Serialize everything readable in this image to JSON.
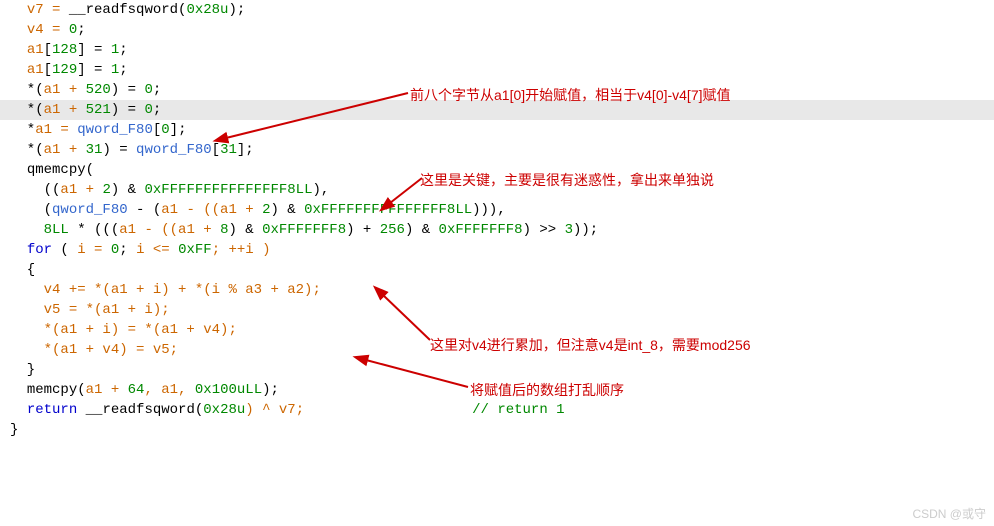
{
  "code": {
    "l1_v": "v7 = ",
    "l1_f": "__readfsqword",
    "l1_n": "0x28u",
    "l2_v": "v4 = ",
    "l2_n": "0",
    "l3_v": "a1",
    "l3_i": "128",
    "l3_n": "1",
    "l4_v": "a1",
    "l4_i": "129",
    "l4_n": "1",
    "l5_v": "a1 + ",
    "l5_i": "520",
    "l5_n": "0",
    "l6_v": "a1 + ",
    "l6_i": "521",
    "l6_n": "0",
    "l7_v": "a1 = ",
    "l7_a": "qword_F80",
    "l7_i": "0",
    "l8_v": "a1 + ",
    "l8_i": "31",
    "l8_a": "qword_F80",
    "l8_i2": "31",
    "l9": "qmemcpy(",
    "l10_v1": "a1 + ",
    "l10_n1": "2",
    "l10_n2": "0xFFFFFFFFFFFFFFF8LL",
    "l11_a": "qword_F80",
    "l11_v": "a1 - ((a1 + ",
    "l11_n1": "2",
    "l11_n2": "0xFFFFFFFFFFFFFFF8LL",
    "l12_n1": "8LL",
    "l12_v1": "a1 - ((a1 + ",
    "l12_n2": "8",
    "l12_n3": "0xFFFFFFF8",
    "l12_n4": "256",
    "l12_n5": "0xFFFFFFF8",
    "l12_n6": "3",
    "l13_k": "for",
    "l13_v": "i = ",
    "l13_n1": "0",
    "l13_v2": "i <= ",
    "l13_n2": "0xFF",
    "l13_v3": "; ++i )",
    "l15_v1": "v4 += *(a1 + i) + *(i % a3 + a2);",
    "l16_v": "v5 = *(a1 + i);",
    "l17_v": "*(a1 + i) = *(a1 + v4);",
    "l18_v": "*(a1 + v4) = v5;",
    "l20_f": "memcpy",
    "l20_v": "a1 + ",
    "l20_n1": "64",
    "l20_v2": ", a1, ",
    "l20_n2": "0x100uLL",
    "l21_k": "return",
    "l21_f": "__readfsqword",
    "l21_n": "0x28u",
    "l21_v": ") ^ v7;",
    "l21_c": "// return 1"
  },
  "annotations": {
    "a1": "前八个字节从a1[0]开始赋值，相当于v4[0]-v4[7]赋值",
    "a2": "这里是关键，主要是很有迷惑性，拿出来单独说",
    "a3": "这里对v4进行累加，但注意v4是int_8，需要mod256",
    "a4": "将赋值后的数组打乱顺序"
  },
  "watermark": "CSDN @或守"
}
